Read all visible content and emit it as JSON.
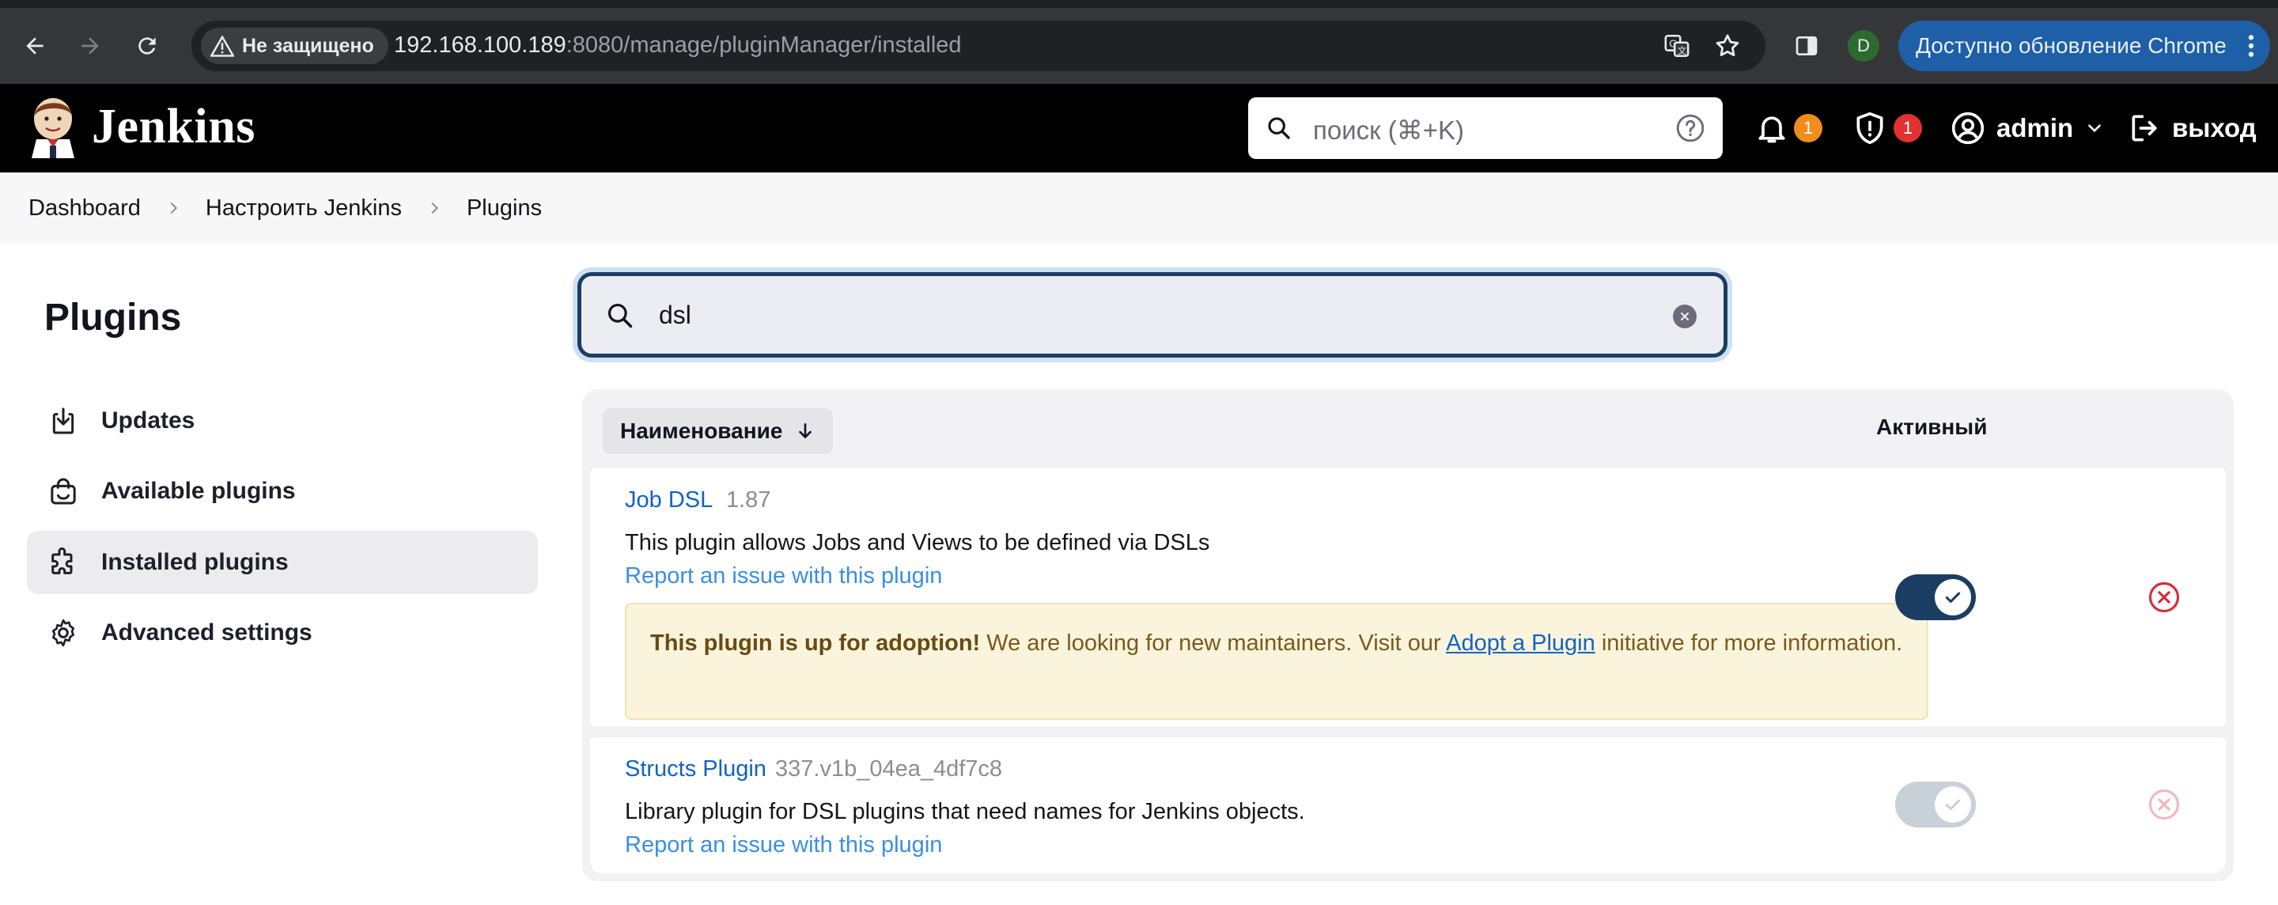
{
  "browser": {
    "security_label": "Не защищено",
    "url_host": "192.168.100.189",
    "url_rest": ":8080/manage/pluginManager/installed",
    "profile_initial": "D",
    "update_label": "Доступно обновление Chrome"
  },
  "header": {
    "logo_text": "Jenkins",
    "search_placeholder": "поиск (⌘+K)",
    "notifications_count": "1",
    "security_count": "1",
    "user": "admin",
    "logout": "выход"
  },
  "breadcrumb": [
    "Dashboard",
    "Настроить Jenkins",
    "Plugins"
  ],
  "sidebar": {
    "title": "Plugins",
    "items": [
      {
        "label": "Updates",
        "icon": "download-icon"
      },
      {
        "label": "Available plugins",
        "icon": "shopping-bag-icon"
      },
      {
        "label": "Installed plugins",
        "icon": "puzzle-icon"
      },
      {
        "label": "Advanced settings",
        "icon": "gear-icon"
      }
    ]
  },
  "filter": {
    "value": "dsl"
  },
  "table": {
    "col_name": "Наименование",
    "col_active": "Активный",
    "plugins": [
      {
        "name": "Job DSL",
        "version": "1.87",
        "description": "This plugin allows Jobs and Views to be defined via DSLs",
        "report": "Report an issue with this plugin",
        "adoption_strong": "This plugin is up for adoption!",
        "adoption_text": " We are looking for new maintainers. Visit our ",
        "adoption_link": "Adopt a Plugin",
        "adoption_tail": " initiative for more information.",
        "enabled": true
      },
      {
        "name": "Structs Plugin",
        "version": "337.v1b_04ea_4df7c8",
        "description": "Library plugin for DSL plugins that need names for Jenkins objects.",
        "report": "Report an issue with this plugin",
        "enabled": true,
        "disabled_control": true
      }
    ]
  },
  "colors": {
    "accent": "#1c3d63",
    "link": "#1263c2",
    "badge_orange": "#f28c1c",
    "badge_red": "#e03232",
    "danger": "#d62f3a"
  }
}
